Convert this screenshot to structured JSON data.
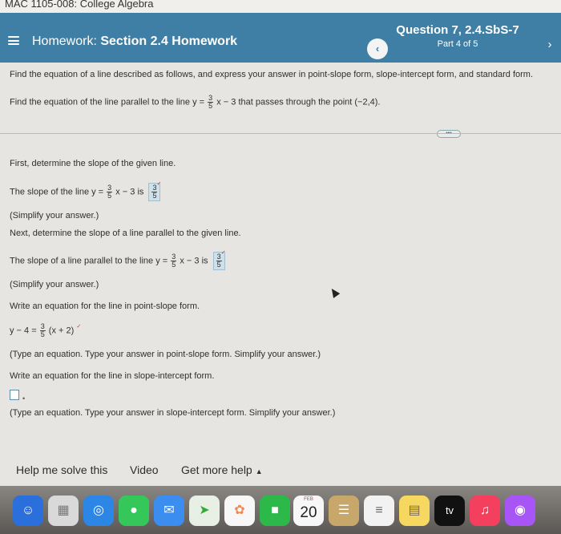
{
  "browser_tab": {
    "title": "MAC 1105-008: College Algebra"
  },
  "header": {
    "homework_prefix": "Homework:",
    "homework_title": "Section 2.4 Homework",
    "question_title": "Question 7, 2.4.SbS-7",
    "question_part": "Part 4 of 5",
    "prev_icon": "chevron-left-icon",
    "next_icon": "chevron-right-icon",
    "accent_color": "#3f7fa5"
  },
  "problem": {
    "instruction": "Find the equation of a line described as follows, and express your answer in point-slope form, slope-intercept form, and standard form.",
    "statement_pre": "Find the equation of the line parallel to the line y =",
    "statement_frac_num": "3",
    "statement_frac_den": "5",
    "statement_post": "x − 3 that passes through the point (−2,4).",
    "more_button": "•••"
  },
  "steps": {
    "step1_intro": "First, determine the slope of the given line.",
    "step1_pre": "The slope of the line y =",
    "step1_frac_num": "3",
    "step1_frac_den": "5",
    "step1_mid": "x − 3 is",
    "step1_ans_num": "3",
    "step1_ans_den": "5",
    "step1_hint": "(Simplify your answer.)",
    "step2_intro": "Next, determine the slope of a line parallel to the given line.",
    "step2_pre": "The slope of a line parallel to the line y =",
    "step2_frac_num": "3",
    "step2_frac_den": "5",
    "step2_mid": "x − 3 is",
    "step2_ans_num": "3",
    "step2_ans_den": "5",
    "step2_hint": "(Simplify your answer.)",
    "step3_intro": "Write an equation for the line in point-slope form.",
    "step3_pre": "y − 4 =",
    "step3_frac_num": "3",
    "step3_frac_den": "5",
    "step3_post": "(x + 2)",
    "step3_hint": "(Type an equation. Type your answer in point-slope form. Simplify your answer.)",
    "step4_intro": "Write an equation for the line in slope-intercept form.",
    "step4_hint": "(Type an equation. Type your answer in slope-intercept form. Simplify your answer.)"
  },
  "footer": {
    "help_label": "Help me solve this",
    "video_label": "Video",
    "more_help_label": "Get more help",
    "more_help_caret": "▲"
  },
  "dock": {
    "calendar_month": "FEB",
    "calendar_day": "20",
    "tv_label": "tv"
  }
}
